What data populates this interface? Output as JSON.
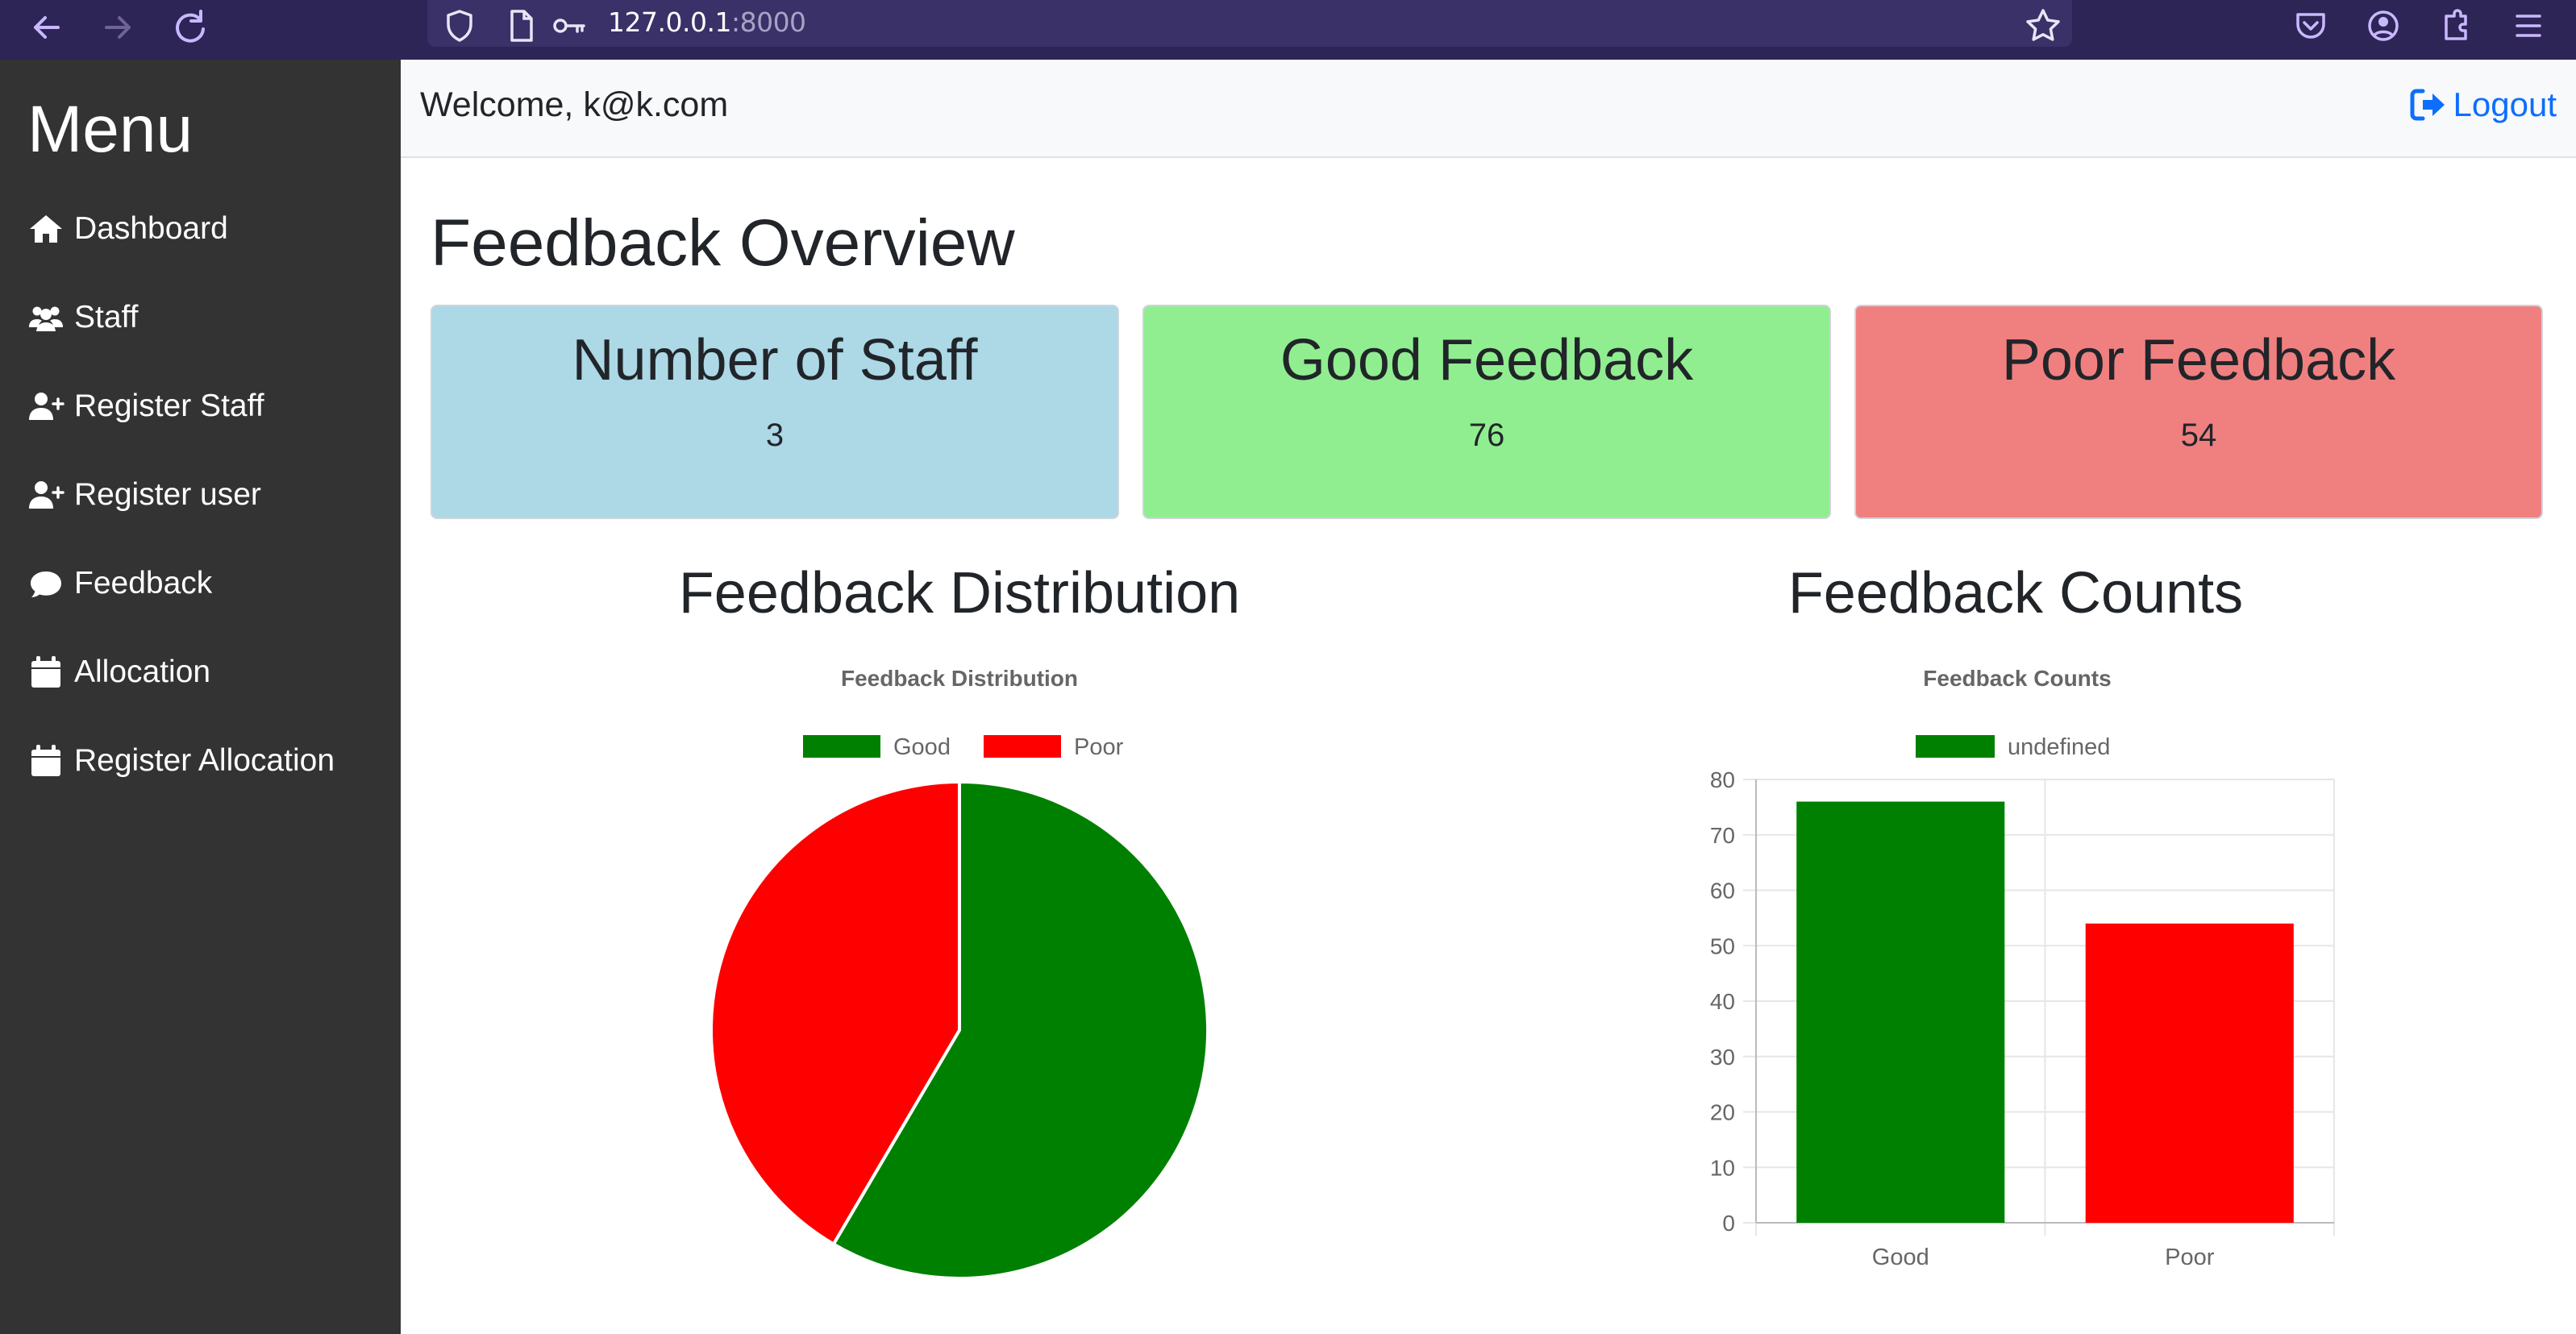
{
  "browser": {
    "url_host": "127.0.0.1",
    "url_port": ":8000"
  },
  "sidebar": {
    "title": "Menu",
    "items": [
      {
        "label": "Dashboard",
        "icon": "home-icon"
      },
      {
        "label": "Staff",
        "icon": "users-icon"
      },
      {
        "label": "Register Staff",
        "icon": "user-plus-icon"
      },
      {
        "label": "Register user",
        "icon": "user-plus-icon"
      },
      {
        "label": "Feedback",
        "icon": "comment-icon"
      },
      {
        "label": "Allocation",
        "icon": "calendar-icon"
      },
      {
        "label": "Register Allocation",
        "icon": "calendar-icon"
      }
    ]
  },
  "topbar": {
    "welcome": "Welcome, k@k.com",
    "logout": "Logout"
  },
  "main": {
    "title": "Feedback Overview",
    "cards": [
      {
        "title": "Number of Staff",
        "value": "3",
        "color": "#add8e6"
      },
      {
        "title": "Good Feedback",
        "value": "76",
        "color": "#90ee90"
      },
      {
        "title": "Poor Feedback",
        "value": "54",
        "color": "#f08080"
      }
    ],
    "pie_heading": "Feedback Distribution",
    "bar_heading": "Feedback Counts"
  },
  "chart_data": [
    {
      "type": "pie",
      "title": "Feedback Distribution",
      "categories": [
        "Good",
        "Poor"
      ],
      "values": [
        76,
        54
      ],
      "colors": [
        "#008000",
        "#ff0000"
      ],
      "legend": "top"
    },
    {
      "type": "bar",
      "title": "Feedback Counts",
      "categories": [
        "Good",
        "Poor"
      ],
      "series": [
        {
          "name": "undefined",
          "values": [
            76,
            54
          ]
        }
      ],
      "colors": [
        "#008000",
        "#ff0000"
      ],
      "ylim": [
        0,
        80
      ],
      "yticks": [
        0,
        10,
        20,
        30,
        40,
        50,
        60,
        70,
        80
      ],
      "grid": true,
      "legend": "top"
    }
  ]
}
